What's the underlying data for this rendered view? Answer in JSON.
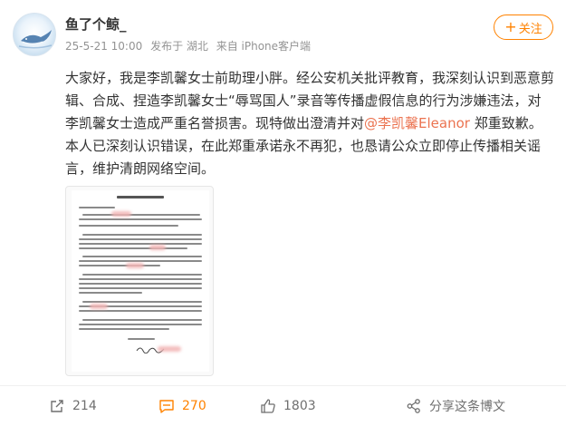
{
  "user": {
    "name": "鱼了个鲸_",
    "follow_label": "关注",
    "follow_plus": "+"
  },
  "meta": {
    "time": "25-5-21 10:00",
    "location": "发布于 湖北",
    "source": "来自 iPhone客户端"
  },
  "post": {
    "text_before": "大家好，我是李凯馨女士前助理小胖。经公安机关批评教育，我深刻认识到恶意剪辑、合成、捏造李凯馨女士“辱骂国人”录音等传播虚假信息的行为涉嫌违法，对李凯馨女士造成严重名誉损害。现特做出澄清并对",
    "mention": "@李凯馨Eleanor",
    "text_after": " 郑重致歉。本人已深刻认识错误，在此郑重承诺永不再犯，也恳请公众立即停止传播相关谣言，维护清朗网络空间。"
  },
  "image": {
    "icon": "document-image-icon"
  },
  "actions": {
    "repost_count": "214",
    "comment_count": "270",
    "like_count": "1803",
    "share_label": "分享这条博文"
  },
  "colors": {
    "accent": "#ff8200",
    "mention": "#eb7350",
    "meta": "#939393",
    "text": "#333333"
  }
}
